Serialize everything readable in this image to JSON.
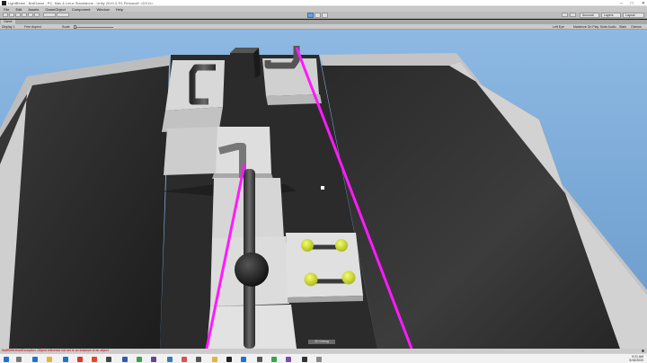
{
  "window": {
    "title": "LightBeam - BallGame - PC, Mac & Linux Standalone - Unity 2019.3.7f1 Personal* <DX11>"
  },
  "menu": [
    "File",
    "Edit",
    "Assets",
    "GameObject",
    "Component",
    "Window",
    "Help"
  ],
  "toolbar": {
    "account_label": "Account",
    "layers_label": "Layers",
    "layout_label": "Layout"
  },
  "tabs": {
    "game_tab": "Game"
  },
  "game_bar": {
    "display": "Display 1",
    "aspect": "Free Aspect",
    "scale_label": "Scale",
    "eye": "Left Eye",
    "maximize": "Maximize On Play",
    "mute": "Mute Audio",
    "stats": "Stats",
    "gizmos": "Gizmos"
  },
  "viewport": {
    "debug_label": "2D Debug"
  },
  "status": {
    "message": "NullReferenceException: Object reference not set to an instance of an object"
  },
  "taskbar": {
    "time": "9:21 AM",
    "date": "5/16/2020"
  },
  "colors": {
    "beam": "#ff1aff",
    "sky": "#7fb0dc",
    "accent": "#c9d62a"
  }
}
